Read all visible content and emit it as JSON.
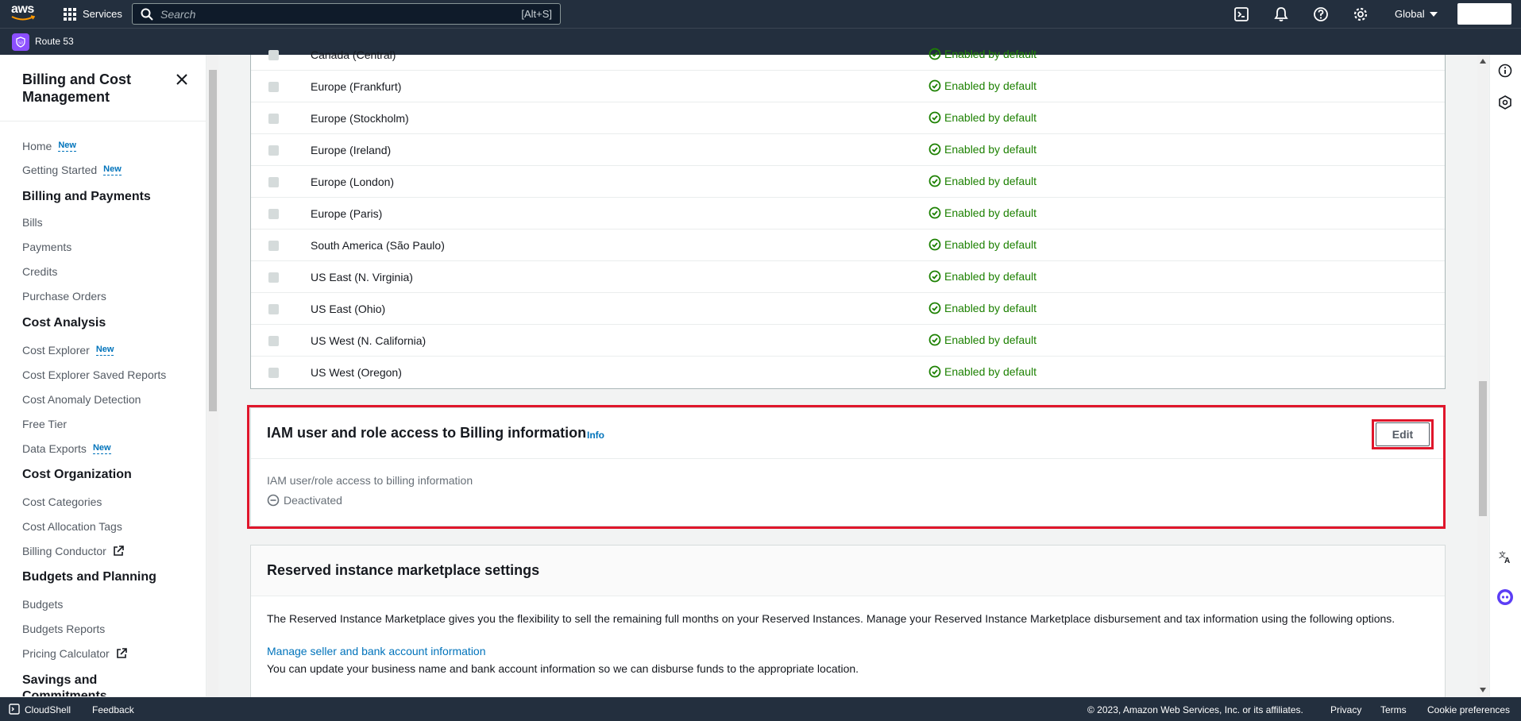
{
  "topbar": {
    "logo_text": "aws",
    "services_label": "Services",
    "search_placeholder": "Search",
    "search_shortcut": "[Alt+S]",
    "region_label": "Global"
  },
  "subbar": {
    "service_label": "Route 53"
  },
  "sidebar": {
    "title": "Billing and Cost Management",
    "new_badge": "New",
    "items": [
      {
        "label": "Home",
        "new": true
      },
      {
        "label": "Getting Started",
        "new": true
      },
      {
        "heading": "Billing and Payments"
      },
      {
        "label": "Bills"
      },
      {
        "label": "Payments"
      },
      {
        "label": "Credits"
      },
      {
        "label": "Purchase Orders"
      },
      {
        "heading": "Cost Analysis"
      },
      {
        "label": "Cost Explorer",
        "new": true
      },
      {
        "label": "Cost Explorer Saved Reports"
      },
      {
        "label": "Cost Anomaly Detection"
      },
      {
        "label": "Free Tier"
      },
      {
        "label": "Data Exports",
        "new": true
      },
      {
        "heading": "Cost Organization"
      },
      {
        "label": "Cost Categories"
      },
      {
        "label": "Cost Allocation Tags"
      },
      {
        "label": "Billing Conductor",
        "external": true
      },
      {
        "heading": "Budgets and Planning"
      },
      {
        "label": "Budgets"
      },
      {
        "label": "Budgets Reports"
      },
      {
        "label": "Pricing Calculator",
        "external": true
      },
      {
        "heading": "Savings and Commitments"
      }
    ]
  },
  "regions_table": {
    "status_text": "Enabled by default",
    "rows": [
      "Canada (Central)",
      "Europe (Frankfurt)",
      "Europe (Stockholm)",
      "Europe (Ireland)",
      "Europe (London)",
      "Europe (Paris)",
      "South America (São Paulo)",
      "US East (N. Virginia)",
      "US East (Ohio)",
      "US West (N. California)",
      "US West (Oregon)"
    ]
  },
  "iam_section": {
    "title": "IAM user and role access to Billing information",
    "info_label": "Info",
    "edit_label": "Edit",
    "field_label": "IAM user/role access to billing information",
    "field_value": "Deactivated"
  },
  "ri_section": {
    "title": "Reserved instance marketplace settings",
    "description": "The Reserved Instance Marketplace gives you the flexibility to sell the remaining full months on your Reserved Instances. Manage your Reserved Instance Marketplace disbursement and tax information using the following options.",
    "link_label": "Manage seller and bank account information",
    "link_description": "You can update your business name and bank account information so we can disburse funds to the appropriate location."
  },
  "footer": {
    "cloudshell": "CloudShell",
    "feedback": "Feedback",
    "copyright": "© 2023, Amazon Web Services, Inc. or its affiliates.",
    "privacy": "Privacy",
    "terms": "Terms",
    "cookies": "Cookie preferences"
  },
  "colors": {
    "nav_bg": "#232f3e",
    "success": "#1d8102",
    "link": "#0073bb",
    "highlight": "#e0162b"
  }
}
